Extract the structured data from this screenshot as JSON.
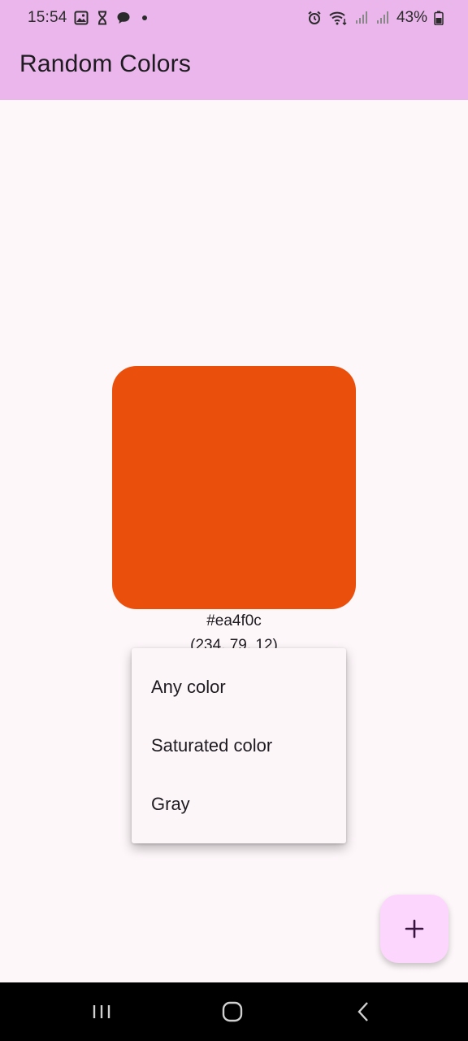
{
  "status_bar": {
    "time": "15:54",
    "battery": "43%",
    "left_icons": [
      "image-icon",
      "hourglass-icon",
      "chat-bubble-icon",
      "dot-icon"
    ],
    "right_icons": [
      "alarm-icon",
      "wifi-icon",
      "signal-icon",
      "signal-icon-2",
      "battery-icon"
    ]
  },
  "app_bar": {
    "title": "Random Colors",
    "color": "#eab6eb"
  },
  "color_display": {
    "swatch_color": "#ea4f0c",
    "hex": "#ea4f0c",
    "rgb": "(234, 79, 12)"
  },
  "menu": {
    "items": [
      {
        "label": "Any color"
      },
      {
        "label": "Saturated color"
      },
      {
        "label": "Gray"
      }
    ]
  },
  "fab": {
    "icon": "plus-icon",
    "color": "#fcd6fc"
  },
  "nav_bar": {
    "buttons": [
      "recent-apps-icon",
      "home-icon",
      "back-icon"
    ]
  }
}
